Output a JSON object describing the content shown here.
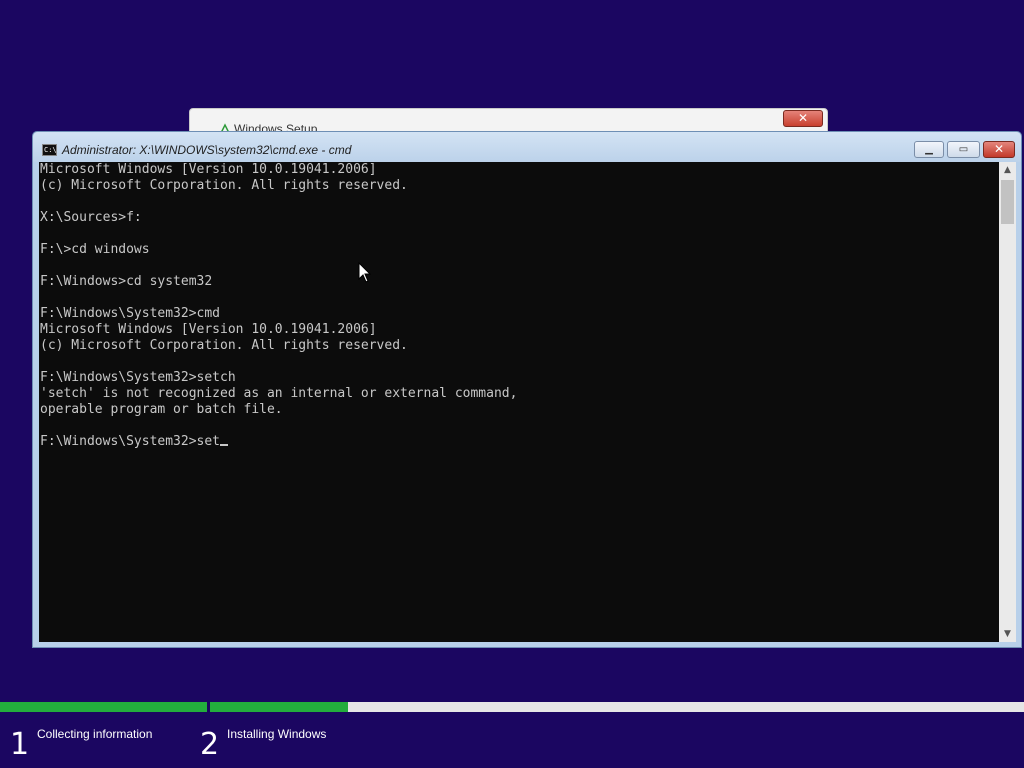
{
  "background_window": {
    "title": "Windows Setup",
    "close_label": "✕"
  },
  "cmd": {
    "title": "Administrator: X:\\WINDOWS\\system32\\cmd.exe - cmd",
    "icon_text": "C:\\",
    "buttons": {
      "minimize": "▁",
      "maximize": "▭",
      "close": "✕"
    },
    "lines": [
      "Microsoft Windows [Version 10.0.19041.2006]",
      "(c) Microsoft Corporation. All rights reserved.",
      "",
      "X:\\Sources>f:",
      "",
      "F:\\>cd windows",
      "",
      "F:\\Windows>cd system32",
      "",
      "F:\\Windows\\System32>cmd",
      "Microsoft Windows [Version 10.0.19041.2006]",
      "(c) Microsoft Corporation. All rights reserved.",
      "",
      "F:\\Windows\\System32>setch",
      "'setch' is not recognized as an internal or external command,",
      "operable program or batch file.",
      ""
    ],
    "current_input": "F:\\Windows\\System32>set",
    "scroll": {
      "up_arrow": "▲",
      "down_arrow": "▼"
    }
  },
  "setup_progress": {
    "steps": [
      {
        "number": "1",
        "label": "Collecting information",
        "progress": 1.0
      },
      {
        "number": "2",
        "label": "Installing Windows",
        "progress": 0.17
      }
    ],
    "colors": {
      "fill": "#23ad3d",
      "track": "#e6e6e6",
      "background": "#1b0661"
    }
  }
}
